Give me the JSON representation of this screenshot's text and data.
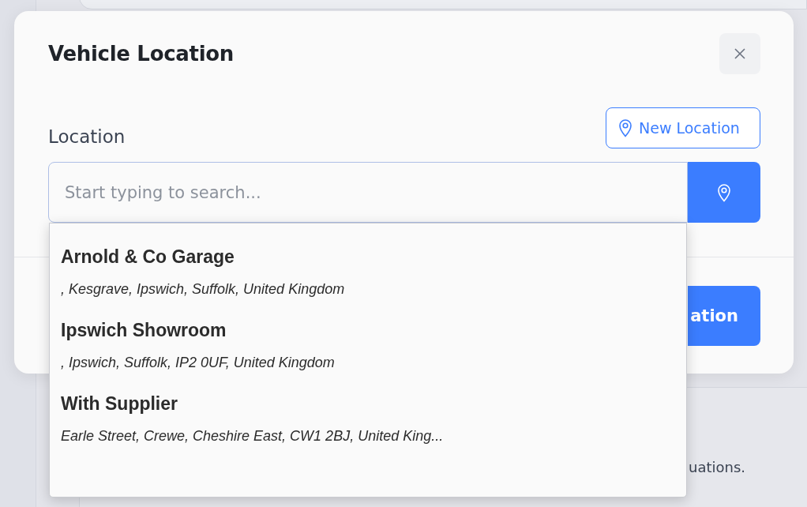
{
  "background": {
    "text_fragment": "uations."
  },
  "modal": {
    "title": "Vehicle Location",
    "location_label": "Location",
    "new_location_button": "New Location",
    "search": {
      "placeholder": "Start typing to search..."
    },
    "footer_button": "ation"
  },
  "suggestions": [
    {
      "name": "Arnold & Co Garage",
      "address": ", Kesgrave, Ipswich, Suffolk, United Kingdom"
    },
    {
      "name": "Ipswich Showroom",
      "address": ", Ipswich, Suffolk, IP2 0UF, United Kingdom"
    },
    {
      "name": "With Supplier",
      "address": "Earle Street, Crewe, Cheshire East, CW1 2BJ, United King..."
    }
  ]
}
